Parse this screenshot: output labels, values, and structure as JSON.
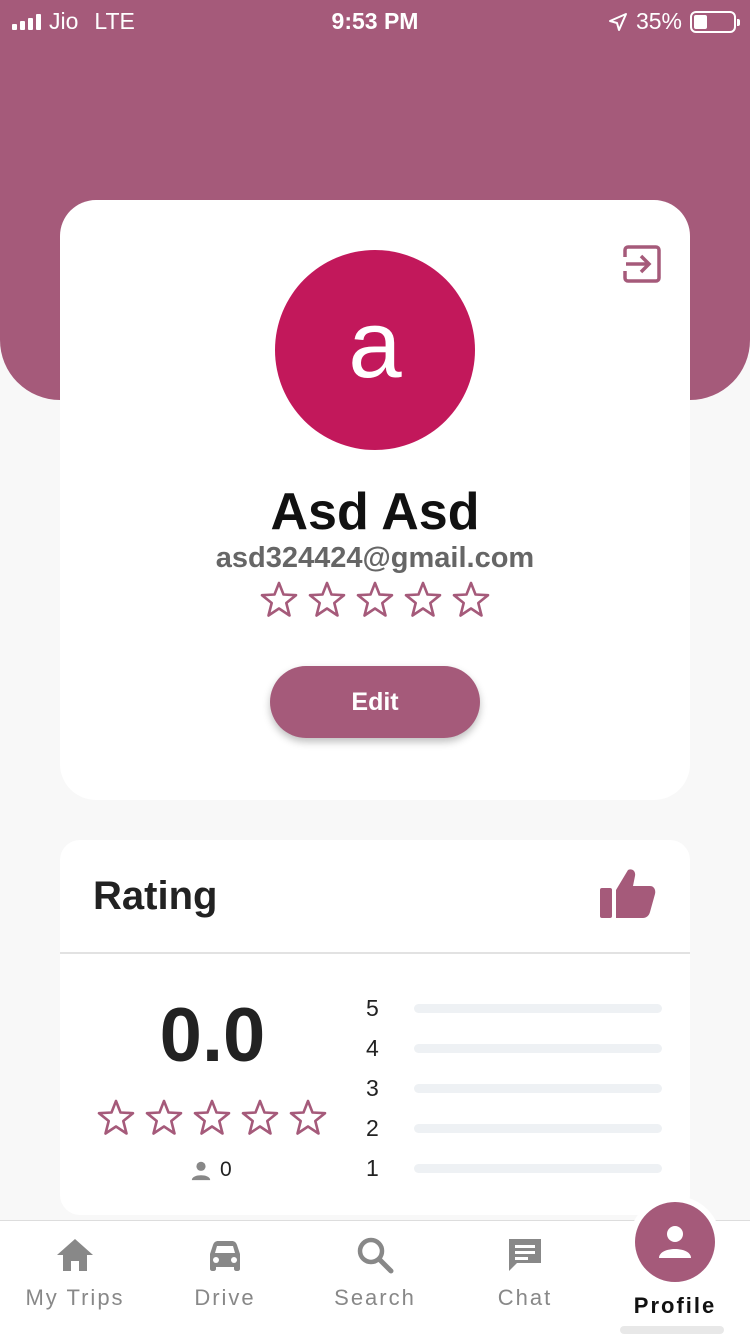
{
  "status_bar": {
    "carrier": "Jio",
    "network": "LTE",
    "time": "9:53 PM",
    "battery": "35%"
  },
  "profile": {
    "avatar_letter": "a",
    "name": "Asd Asd",
    "email": "asd324424@gmail.com",
    "stars": 0,
    "edit_label": "Edit"
  },
  "rating": {
    "title": "Rating",
    "value": "0.0",
    "count": "0",
    "breakdown": [
      {
        "label": "5",
        "fraction": 0
      },
      {
        "label": "4",
        "fraction": 0
      },
      {
        "label": "3",
        "fraction": 0
      },
      {
        "label": "2",
        "fraction": 0
      },
      {
        "label": "1",
        "fraction": 0
      }
    ]
  },
  "nav": {
    "items": [
      {
        "label": "My Trips",
        "icon": "home-icon"
      },
      {
        "label": "Drive",
        "icon": "car-icon"
      },
      {
        "label": "Search",
        "icon": "search-icon"
      },
      {
        "label": "Chat",
        "icon": "chat-icon"
      },
      {
        "label": "Profile",
        "icon": "person-icon",
        "active": true
      }
    ]
  },
  "colors": {
    "accent": "#a55a7a",
    "avatar": "#c2185b",
    "star_outline": "#a55a7a"
  }
}
